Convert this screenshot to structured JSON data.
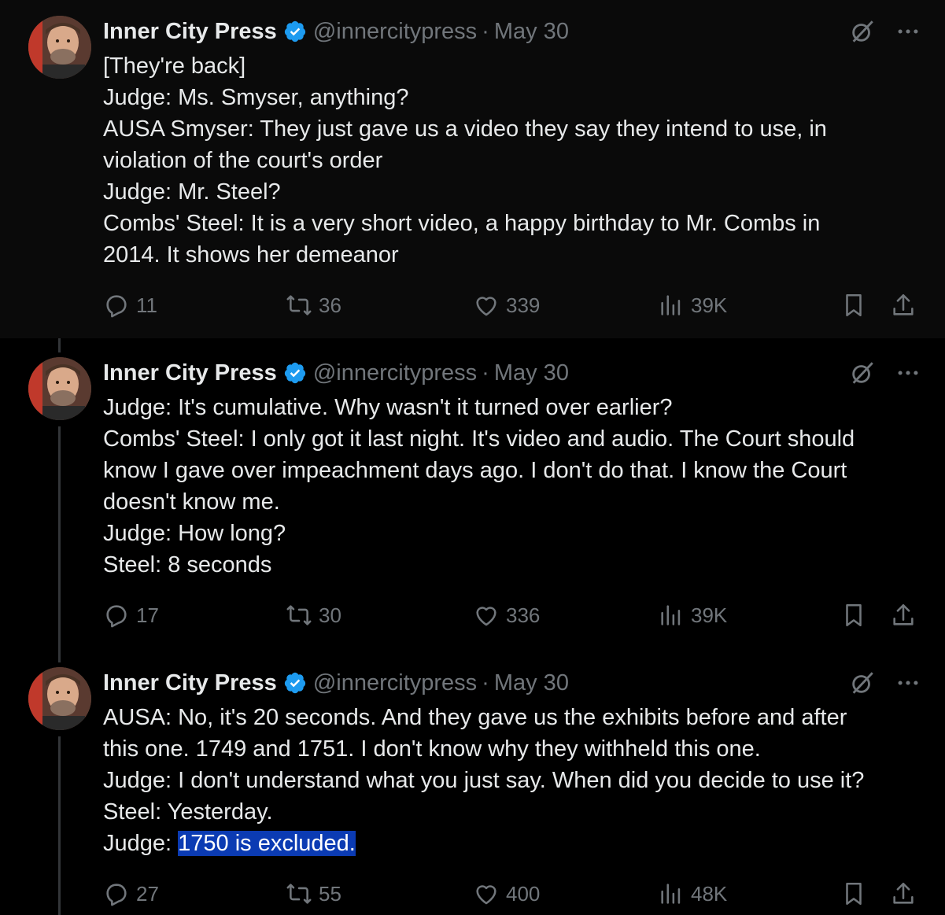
{
  "tweets": [
    {
      "name": "Inner City Press",
      "handle": "@innercitypress",
      "separator": "·",
      "date": "May 30",
      "lines": [
        "[They're back]",
        "Judge: Ms. Smyser, anything?",
        "AUSA Smyser: They just gave us a video they say they intend to use, in",
        "violation of the court's order",
        "Judge: Mr. Steel?",
        "Combs' Steel: It is a very short video, a happy birthday to Mr. Combs in",
        "2014. It shows her demeanor"
      ],
      "replies": "11",
      "reposts": "36",
      "likes": "339",
      "views": "39K"
    },
    {
      "name": "Inner City Press",
      "handle": "@innercitypress",
      "separator": "·",
      "date": "May 30",
      "lines": [
        "Judge: It's cumulative. Why wasn't it turned over earlier?",
        "Combs' Steel: I only got it last night. It's video and audio. The Court should",
        "know I gave over impeachment days ago. I don't do that. I know the Court",
        "doesn't know me.",
        "Judge: How long?",
        "Steel: 8 seconds"
      ],
      "replies": "17",
      "reposts": "30",
      "likes": "336",
      "views": "39K"
    },
    {
      "name": "Inner City Press",
      "handle": "@innercitypress",
      "separator": "·",
      "date": "May 30",
      "lines": [
        "AUSA: No, it's 20 seconds. And they gave us the exhibits before and after",
        "this one. 1749 and 1751. I don't know why they withheld this one.",
        "Judge: I don't understand what you just say. When did you decide to use it?",
        "Steel: Yesterday."
      ],
      "last_line_prefix": "Judge: ",
      "last_line_selected": "1750 is excluded.",
      "replies": "27",
      "reposts": "55",
      "likes": "400",
      "views": "48K"
    }
  ],
  "colors": {
    "background": "#000000",
    "text": "#e7e9ea",
    "muted": "#71767b",
    "verified": "#1d9bf0",
    "selection": "#0b3bb3"
  }
}
